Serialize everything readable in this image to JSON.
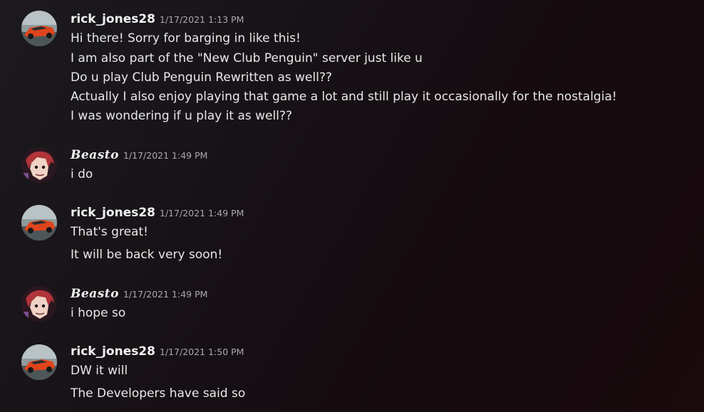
{
  "messages": [
    {
      "author": "rick_jones28",
      "timestamp": "1/17/2021 1:13 PM",
      "lines": [
        "Hi there! Sorry for barging in like this!",
        "I am also part of the \"New Club Penguin\" server just like u",
        "Do u play Club Penguin Rewritten as well??",
        "Actually I also enjoy playing that game a lot and still play it occasionally for the nostalgia!",
        "I was wondering if u play it as well??"
      ]
    },
    {
      "author": "Beasto",
      "timestamp": "1/17/2021 1:49 PM",
      "lines": [
        "i do"
      ]
    },
    {
      "author": "rick_jones28",
      "timestamp": "1/17/2021 1:49 PM",
      "lines": [
        "That's great!",
        "It will be back very soon!"
      ]
    },
    {
      "author": "Beasto",
      "timestamp": "1/17/2021 1:49 PM",
      "lines": [
        "i hope so"
      ]
    },
    {
      "author": "rick_jones28",
      "timestamp": "1/17/2021 1:50 PM",
      "lines": [
        "DW it will",
        "The Developers have said so"
      ]
    }
  ]
}
